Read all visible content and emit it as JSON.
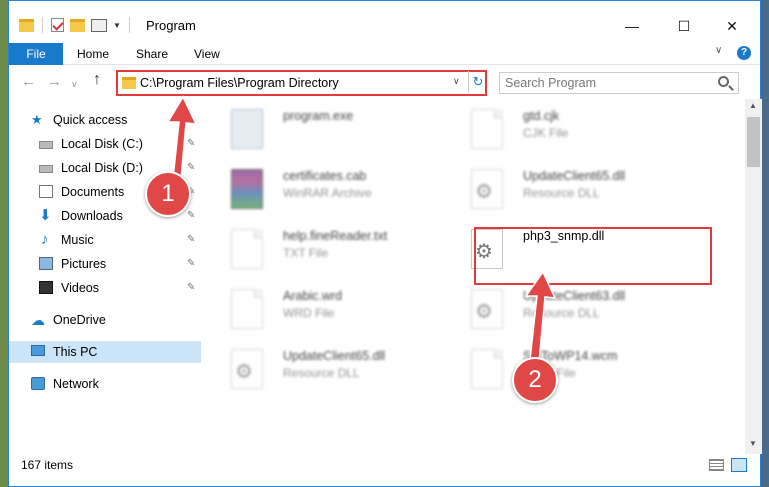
{
  "window": {
    "title": "Program",
    "minimize_glyph": "—",
    "maximize_glyph": "☐",
    "close_glyph": "✕"
  },
  "ribbon": {
    "tabs": [
      "File",
      "Home",
      "Share",
      "View"
    ],
    "expand_glyph": "∨",
    "help_glyph": "?"
  },
  "nav": {
    "back_glyph": "←",
    "forward_glyph": "→",
    "recent_glyph": "∨",
    "up_glyph": "↑",
    "address": "C:\\Program Files\\Program Directory",
    "address_dropdown_glyph": "∨",
    "refresh_glyph": "↻",
    "search_placeholder": "Search Program"
  },
  "sidebar": {
    "items": [
      {
        "label": "Quick access",
        "icon": "star-icon",
        "pinned": false
      },
      {
        "label": "Local Disk (C:)",
        "icon": "disk-icon",
        "pinned": true
      },
      {
        "label": "Local Disk (D:)",
        "icon": "disk-icon",
        "pinned": true
      },
      {
        "label": "Documents",
        "icon": "documents-icon",
        "pinned": true
      },
      {
        "label": "Downloads",
        "icon": "download-icon",
        "pinned": true
      },
      {
        "label": "Music",
        "icon": "music-icon",
        "pinned": true
      },
      {
        "label": "Pictures",
        "icon": "pictures-icon",
        "pinned": true
      },
      {
        "label": "Videos",
        "icon": "videos-icon",
        "pinned": true
      },
      {
        "label": "OneDrive",
        "icon": "onedrive-icon",
        "pinned": false
      },
      {
        "label": "This PC",
        "icon": "this-pc-icon",
        "pinned": false,
        "selected": true
      },
      {
        "label": "Network",
        "icon": "network-icon",
        "pinned": false
      }
    ],
    "pin_glyph": "📌"
  },
  "files": [
    {
      "name": "program.exe",
      "type": "",
      "icon": "exe-icon",
      "blurred": true
    },
    {
      "name": "gtd.cjk",
      "type": "CJK File",
      "icon": "page-icon",
      "blurred": true
    },
    {
      "name": "certificates.cab",
      "type": "WinRAR Archive",
      "icon": "winrar-icon",
      "blurred": true
    },
    {
      "name": "UpdateClient65.dll",
      "type": "Resource DLL",
      "icon": "dll-icon",
      "blurred": true
    },
    {
      "name": "help.fineReader.txt",
      "type": "TXT File",
      "icon": "page-icon",
      "blurred": true
    },
    {
      "name": "php3_snmp.dll",
      "type": "",
      "icon": "dll-icon",
      "blurred": false
    },
    {
      "name": "Arabic.wrd",
      "type": "WRD File",
      "icon": "page-icon",
      "blurred": true
    },
    {
      "name": "UpdateClient63.dll",
      "type": "Resource DLL",
      "icon": "dll-icon",
      "blurred": true
    },
    {
      "name": "UpdateClient65.dll",
      "type": "Resource DLL",
      "icon": "dll-icon",
      "blurred": true
    },
    {
      "name": "SldToWP14.wcm",
      "type": "WCM File",
      "icon": "page-icon",
      "blurred": true
    }
  ],
  "status": {
    "item_count": "167 items"
  },
  "annotations": {
    "step1": "1",
    "step2": "2",
    "highlight_color": "#e03a3a"
  }
}
